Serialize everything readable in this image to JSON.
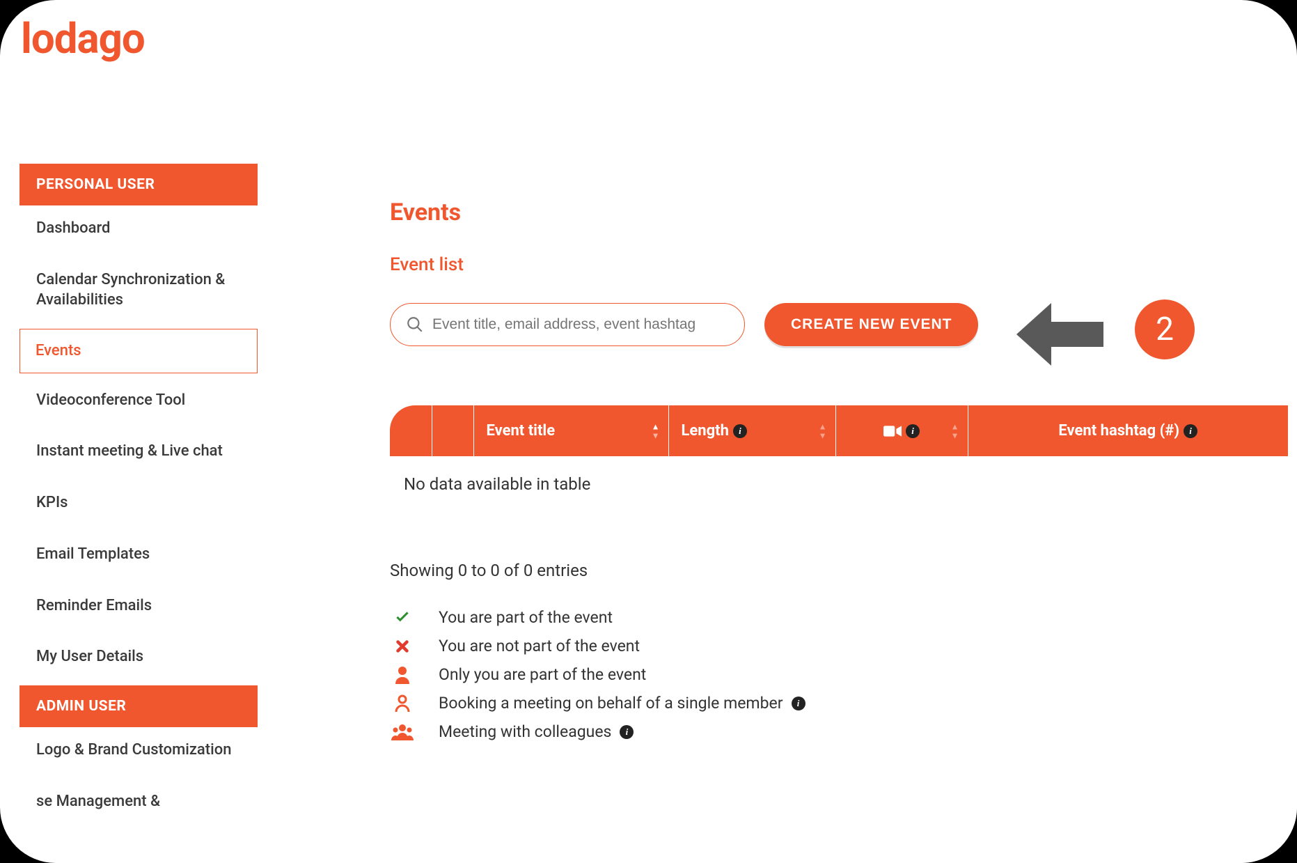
{
  "brand": {
    "logo_text": "lodago"
  },
  "sidebar": {
    "section1_label": "PERSONAL USER",
    "section2_label": "ADMIN USER",
    "items1": [
      {
        "label": "Dashboard",
        "active": false
      },
      {
        "label": "Calendar Synchronization & Availabilities",
        "active": false
      },
      {
        "label": "Events",
        "active": true
      },
      {
        "label": "Videoconference Tool",
        "active": false
      },
      {
        "label": "Instant meeting & Live chat",
        "active": false
      },
      {
        "label": "KPIs",
        "active": false
      },
      {
        "label": "Email Templates",
        "active": false
      },
      {
        "label": "Reminder Emails",
        "active": false
      },
      {
        "label": "My User Details",
        "active": false
      }
    ],
    "items2": [
      {
        "label": "Logo & Brand Customization"
      },
      {
        "label": "se Management &"
      }
    ]
  },
  "main": {
    "title": "Events",
    "subtitle": "Event list",
    "search_placeholder": "Event title, email address, event hashtag",
    "create_button": "CREATE NEW EVENT",
    "table": {
      "col_event_title": "Event title",
      "col_length": "Length",
      "col_hashtag": "Event hashtag (#)",
      "empty_text": "No data available in table"
    },
    "showing_text": "Showing 0 to 0 of 0 entries",
    "legend": [
      {
        "icon": "check",
        "text": "You are part of the event"
      },
      {
        "icon": "cross",
        "text": "You are not part of the event"
      },
      {
        "icon": "person",
        "text": "Only you are part of the event"
      },
      {
        "icon": "person-outline",
        "text": "Booking a meeting on behalf of a single member",
        "info": true
      },
      {
        "icon": "group",
        "text": "Meeting with colleagues",
        "info": true
      }
    ]
  },
  "annotation": {
    "step": "2"
  }
}
